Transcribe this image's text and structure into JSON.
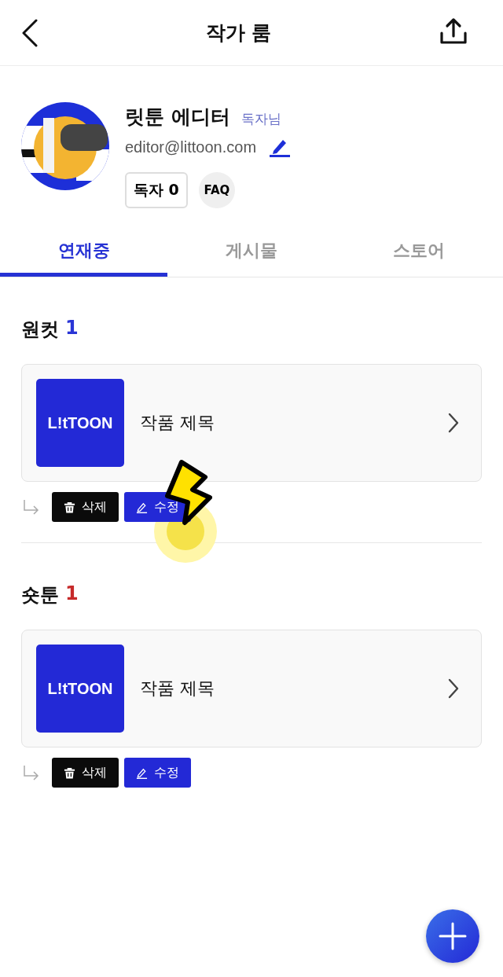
{
  "header": {
    "title": "작가 룸"
  },
  "profile": {
    "name": "릿툰 에디터",
    "role": "독자님",
    "email": "editor@littoon.com",
    "readers": "독자 0",
    "faq": "FAQ"
  },
  "tabs": [
    {
      "label": "연재중",
      "selected": true
    },
    {
      "label": "게시물",
      "selected": false
    },
    {
      "label": "스토어",
      "selected": false
    }
  ],
  "sections": [
    {
      "title": "원컷",
      "count": "1",
      "color": "#2a35d6",
      "works": [
        {
          "logo": "L!tTOON",
          "title": "작품 제목",
          "delete": "삭제",
          "edit": "수정"
        }
      ]
    },
    {
      "title": "숏툰",
      "count": "1",
      "color": "#c62a2a",
      "works": [
        {
          "logo": "L!tTOON",
          "title": "작품 제목",
          "delete": "삭제",
          "edit": "수정"
        }
      ]
    }
  ]
}
